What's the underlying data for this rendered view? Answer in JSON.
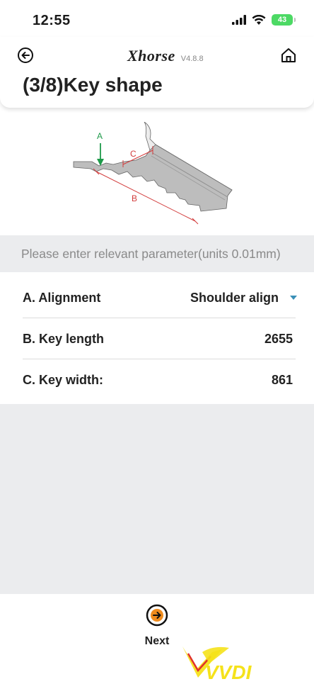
{
  "status_bar": {
    "time": "12:55",
    "battery_level": "43",
    "icons": [
      "signal-icon",
      "wifi-icon",
      "battery-icon"
    ]
  },
  "header": {
    "brand": "Xhorse",
    "version": "V4.8.8",
    "title": "(3/8)Key shape",
    "back_icon": "back-arrow-icon",
    "home_icon": "home-icon"
  },
  "diagram": {
    "labels": {
      "a": "A",
      "b": "B",
      "c": "C"
    },
    "colors": {
      "a_arrow": "#1e9a4a",
      "dimension": "#d23b3b",
      "key": "#b5b5b5"
    }
  },
  "instruction": "Please enter relevant parameter(units 0.01mm)",
  "params": [
    {
      "label": "A. Alignment",
      "value": "Shoulder align",
      "type": "select"
    },
    {
      "label": "B. Key length",
      "value": "2655",
      "type": "number"
    },
    {
      "label": "C. Key width:",
      "value": "861",
      "type": "number"
    }
  ],
  "footer": {
    "next_label": "Next",
    "next_icon": "arrow-right-circle-icon",
    "accent": "#f08c1e"
  },
  "watermark": {
    "text": "VVDI",
    "colors": {
      "primary": "#f5e21b",
      "secondary": "#e0312b"
    }
  },
  "colors": {
    "background_grey": "#ebecee",
    "divider": "#dcdcdc",
    "caret": "#3a8fb7"
  }
}
